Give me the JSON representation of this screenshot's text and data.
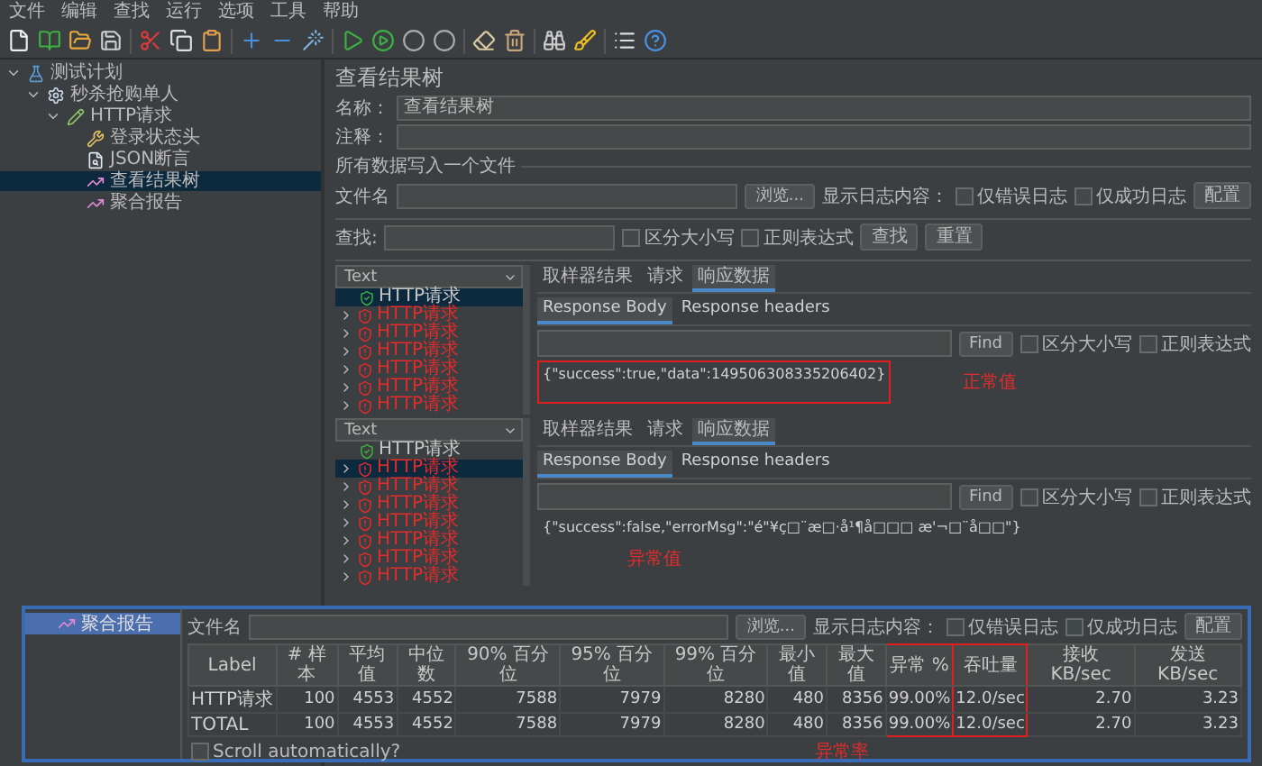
{
  "menu": [
    "文件",
    "编辑",
    "查找",
    "运行",
    "选项",
    "工具",
    "帮助"
  ],
  "tree": [
    {
      "label": "测试计划",
      "kind": "plan",
      "selected": false,
      "expanded": true,
      "children": [
        {
          "label": "秒杀抢购单人",
          "kind": "thread-group",
          "selected": false,
          "expanded": true,
          "children": [
            {
              "label": "HTTP请求",
              "kind": "sampler",
              "selected": false,
              "expanded": true,
              "children": [
                {
                  "label": "登录状态头",
                  "kind": "header",
                  "selected": false
                },
                {
                  "label": "JSON断言",
                  "kind": "assertion",
                  "selected": false
                },
                {
                  "label": "查看结果树",
                  "kind": "listener",
                  "selected": true
                },
                {
                  "label": "聚合报告",
                  "kind": "listener",
                  "selected": false
                }
              ]
            }
          ]
        }
      ]
    }
  ],
  "editor": {
    "title": "查看结果树",
    "name_label": "名称：",
    "name_value": "查看结果树",
    "comment_label": "注释：",
    "file_group": "所有数据写入一个文件",
    "file_label": "文件名",
    "browse": "浏览...",
    "log_label": "显示日志内容：",
    "errors_only": {
      "label": "仅错误日志",
      "checked": false
    },
    "success_only": {
      "label": "仅成功日志",
      "checked": false
    },
    "configure": "配置"
  },
  "search": {
    "label": "查找:",
    "case": {
      "label": "区分大小写",
      "checked": false
    },
    "regex": {
      "label": "正则表达式",
      "checked": false
    },
    "find": "查找",
    "reset": "重置"
  },
  "results": [
    {
      "renderer": "Text",
      "samples": [
        {
          "label": "HTTP请求",
          "kind": "ok",
          "selected": true
        },
        {
          "label": "HTTP请求",
          "kind": "error",
          "selected": false
        },
        {
          "label": "HTTP请求",
          "kind": "error",
          "selected": false
        },
        {
          "label": "HTTP请求",
          "kind": "error",
          "selected": false
        },
        {
          "label": "HTTP请求",
          "kind": "error",
          "selected": false
        },
        {
          "label": "HTTP请求",
          "kind": "error",
          "selected": false
        },
        {
          "label": "HTTP请求",
          "kind": "error",
          "selected": false
        }
      ],
      "tabs": [
        {
          "label": "取样器结果",
          "selected": false
        },
        {
          "label": "请求",
          "selected": false
        },
        {
          "label": "响应数据",
          "selected": true
        }
      ],
      "subtabs": [
        {
          "label": "Response Body",
          "selected": true
        },
        {
          "label": "Response headers",
          "selected": false
        }
      ],
      "find": "Find",
      "case": {
        "label": "区分大小写",
        "checked": false
      },
      "regex": {
        "label": "正则表达式",
        "checked": false
      },
      "response": "{\"success\":true,\"data\":149506308335206402}",
      "highlighted": true,
      "annotation": "正常值"
    },
    {
      "renderer": "Text",
      "samples": [
        {
          "label": "HTTP请求",
          "kind": "ok",
          "selected": false
        },
        {
          "label": "HTTP请求",
          "kind": "error",
          "selected": true
        },
        {
          "label": "HTTP请求",
          "kind": "error",
          "selected": false
        },
        {
          "label": "HTTP请求",
          "kind": "error",
          "selected": false
        },
        {
          "label": "HTTP请求",
          "kind": "error",
          "selected": false
        },
        {
          "label": "HTTP请求",
          "kind": "error",
          "selected": false
        },
        {
          "label": "HTTP请求",
          "kind": "error",
          "selected": false
        },
        {
          "label": "HTTP请求",
          "kind": "error",
          "selected": false
        }
      ],
      "tabs": [
        {
          "label": "取样器结果",
          "selected": false
        },
        {
          "label": "请求",
          "selected": false
        },
        {
          "label": "响应数据",
          "selected": true
        }
      ],
      "subtabs": [
        {
          "label": "Response Body",
          "selected": true
        },
        {
          "label": "Response headers",
          "selected": false
        }
      ],
      "find": "Find",
      "case": {
        "label": "区分大小写",
        "checked": false
      },
      "regex": {
        "label": "正则表达式",
        "checked": false
      },
      "response": "{\"success\":false,\"errorMsg\":\"é\"¥ç□¨æ□·å¹¶å□□□ æ'¬□¨å□□\"}",
      "highlighted": false,
      "annotation": "异常值"
    }
  ],
  "aggregate": {
    "tree_item": {
      "label": "聚合报告",
      "selected": true
    },
    "file_label": "文件名",
    "browse": "浏览...",
    "log_label": "显示日志内容：",
    "errors_only": {
      "label": "仅错误日志",
      "checked": false
    },
    "success_only": {
      "label": "仅成功日志",
      "checked": false
    },
    "configure": "配置",
    "columns": [
      {
        "label": "Label",
        "highlighted": false
      },
      {
        "label": "# 样本",
        "highlighted": false
      },
      {
        "label": "平均值",
        "highlighted": false
      },
      {
        "label": "中位数",
        "highlighted": false
      },
      {
        "label": "90% 百分位",
        "highlighted": false
      },
      {
        "label": "95% 百分位",
        "highlighted": false
      },
      {
        "label": "99% 百分位",
        "highlighted": false
      },
      {
        "label": "最小值",
        "highlighted": false
      },
      {
        "label": "最大值",
        "highlighted": false
      },
      {
        "label": "异常 %",
        "highlighted": true
      },
      {
        "label": "吞吐量",
        "highlighted": true
      },
      {
        "label": "接收 KB/sec",
        "highlighted": false
      },
      {
        "label": "发送 KB/sec",
        "highlighted": false
      }
    ],
    "rows": [
      [
        "HTTP请求",
        "100",
        "4553",
        "4552",
        "7588",
        "7979",
        "8280",
        "480",
        "8356",
        "99.00%",
        "12.0/sec",
        "2.70",
        "3.23"
      ],
      [
        "TOTAL",
        "100",
        "4553",
        "4552",
        "7588",
        "7979",
        "8280",
        "480",
        "8356",
        "99.00%",
        "12.0/sec",
        "2.70",
        "3.23"
      ]
    ],
    "annotation": "异常率",
    "scroll": {
      "label": "Scroll automatically?",
      "checked": false
    }
  }
}
